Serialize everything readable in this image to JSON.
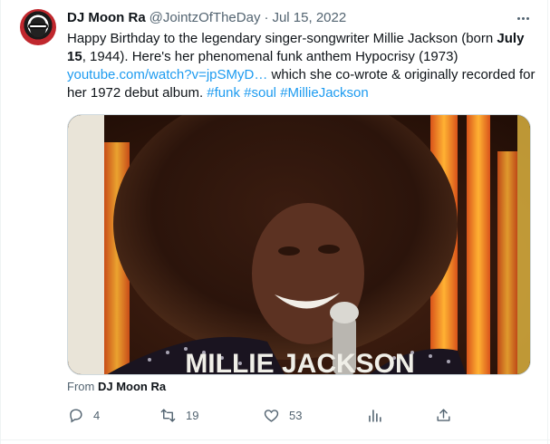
{
  "author": {
    "display_name": "DJ Moon Ra",
    "handle": "@JointzOfTheDay",
    "separator": "·",
    "date": "Jul 15, 2022"
  },
  "tweet": {
    "text_1": "Happy Birthday to the legendary singer-songwriter Millie Jackson (born ",
    "text_bold_1": "July 15",
    "text_2": ", 1944). Here's her phenomenal funk anthem Hypocrisy (1973) ",
    "link": "youtube.com/watch?v=jpSMyD…",
    "text_3": " which she co-wrote & originally recorded for her 1972 debut album. ",
    "hashtags": [
      "#funk",
      "#soul",
      "#MillieJackson"
    ]
  },
  "media": {
    "caption_overlay": "MILLIE JACKSON",
    "from_prefix": "From",
    "from_name": "DJ Moon Ra"
  },
  "actions": {
    "replies": "4",
    "retweets": "19",
    "likes": "53"
  },
  "icons": [
    "avatar",
    "more-icon",
    "reply-icon",
    "retweet-icon",
    "like-icon",
    "views-icon",
    "share-icon"
  ],
  "colors": {
    "link": "#1d9bf0",
    "secondary_text": "#536471",
    "primary_text": "#0f1419"
  }
}
